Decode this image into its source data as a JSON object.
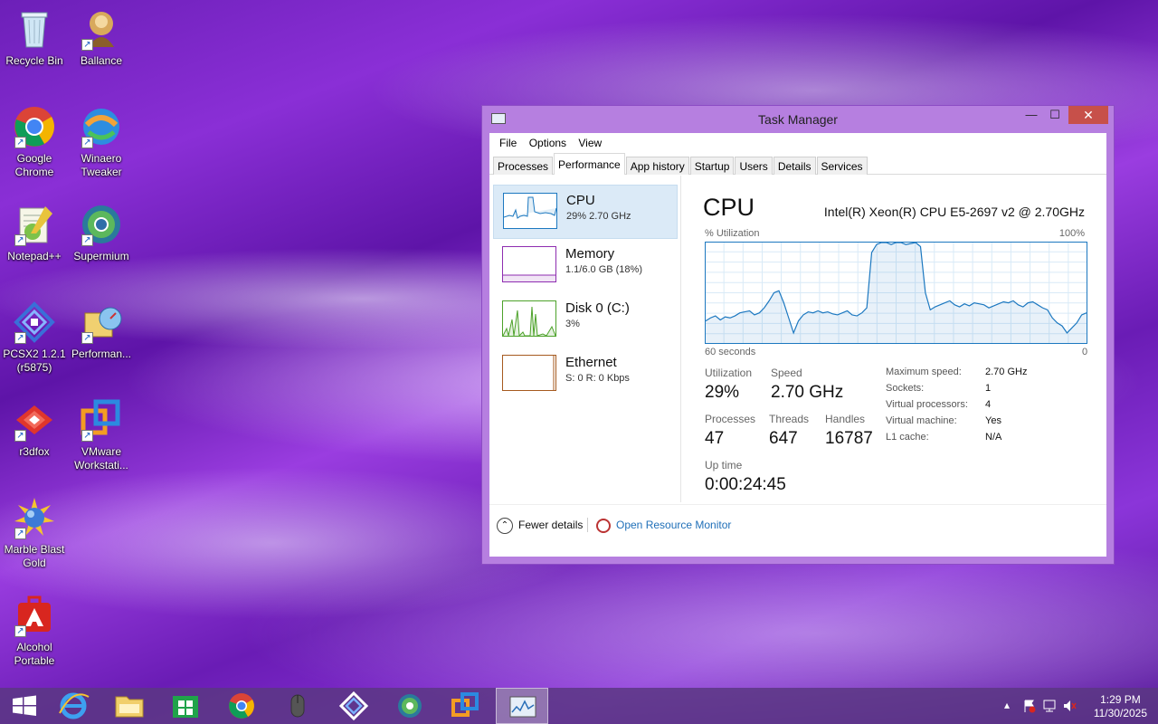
{
  "desktop": {
    "icons": [
      {
        "label": "Recycle Bin"
      },
      {
        "label": "Ballance"
      },
      {
        "label": "Google Chrome"
      },
      {
        "label": "Winaero Tweaker"
      },
      {
        "label": "Notepad++"
      },
      {
        "label": "Supermium"
      },
      {
        "label": "PCSX2 1.2.1 (r5875)"
      },
      {
        "label": "Performan..."
      },
      {
        "label": "r3dfox"
      },
      {
        "label": "VMware Workstati..."
      },
      {
        "label": "Marble Blast Gold"
      },
      {
        "label": "Alcohol Portable"
      }
    ]
  },
  "window": {
    "title": "Task Manager",
    "minimize": "—",
    "maximize": "☐",
    "close": "✕",
    "menu": [
      "File",
      "Options",
      "View"
    ],
    "tabs": [
      "Processes",
      "Performance",
      "App history",
      "Startup",
      "Users",
      "Details",
      "Services"
    ],
    "active_tab": "Performance",
    "resources": [
      {
        "name": "CPU",
        "sub": "29%  2.70 GHz",
        "color": "#1c78c0"
      },
      {
        "name": "Memory",
        "sub": "1.1/6.0 GB (18%)",
        "color": "#8e2db0"
      },
      {
        "name": "Disk 0 (C:)",
        "sub": "3%",
        "color": "#4da22a"
      },
      {
        "name": "Ethernet",
        "sub": "S: 0 R: 0 Kbps",
        "color": "#a65a1f"
      }
    ],
    "detail": {
      "title": "CPU",
      "model": "Intel(R) Xeon(R) CPU E5-2697 v2 @ 2.70GHz",
      "util_label": "% Utilization",
      "util_max": "100%",
      "axis_left": "60 seconds",
      "axis_right": "0",
      "stats": {
        "utilization": {
          "label": "Utilization",
          "value": "29%"
        },
        "speed": {
          "label": "Speed",
          "value": "2.70 GHz"
        },
        "processes": {
          "label": "Processes",
          "value": "47"
        },
        "threads": {
          "label": "Threads",
          "value": "647"
        },
        "handles": {
          "label": "Handles",
          "value": "16787"
        },
        "uptime": {
          "label": "Up time",
          "value": "0:00:24:45"
        }
      },
      "specs": [
        {
          "k": "Maximum speed:",
          "v": "2.70 GHz"
        },
        {
          "k": "Sockets:",
          "v": "1"
        },
        {
          "k": "Virtual processors:",
          "v": "4"
        },
        {
          "k": "Virtual machine:",
          "v": "Yes"
        },
        {
          "k": "L1 cache:",
          "v": "N/A"
        }
      ]
    },
    "footer": {
      "fewer": "Fewer details",
      "orm": "Open Resource Monitor"
    }
  },
  "chart_data": {
    "type": "line",
    "title": "",
    "xlabel": "60 seconds",
    "ylabel": "% Utilization",
    "ylim": [
      0,
      100
    ],
    "series": [
      {
        "name": "",
        "values": [
          22,
          25,
          27,
          23,
          26,
          25,
          27,
          30,
          31,
          32,
          28,
          30,
          35,
          42,
          50,
          52,
          40,
          25,
          10,
          22,
          28,
          31,
          30,
          32,
          30,
          31,
          29,
          28,
          30,
          32,
          28,
          27,
          30,
          35,
          90,
          98,
          100,
          100,
          98,
          100,
          100,
          98,
          99,
          100,
          96,
          50,
          33,
          36,
          38,
          40,
          42,
          38,
          36,
          39,
          37,
          40,
          39,
          38,
          35,
          37,
          39,
          41,
          40,
          42,
          38,
          36,
          40,
          41,
          38,
          35,
          33,
          25,
          20,
          17,
          10,
          15,
          20,
          28,
          30
        ]
      }
    ]
  },
  "taskbar": {
    "items": [
      "start-button",
      "internet-explorer",
      "file-explorer",
      "store",
      "chrome",
      "mouse-app",
      "pcsx2",
      "supermium",
      "vmware",
      "task-manager"
    ],
    "clock_time": "1:29 PM",
    "clock_date": "11/30/2025",
    "tray_up": "▴"
  }
}
